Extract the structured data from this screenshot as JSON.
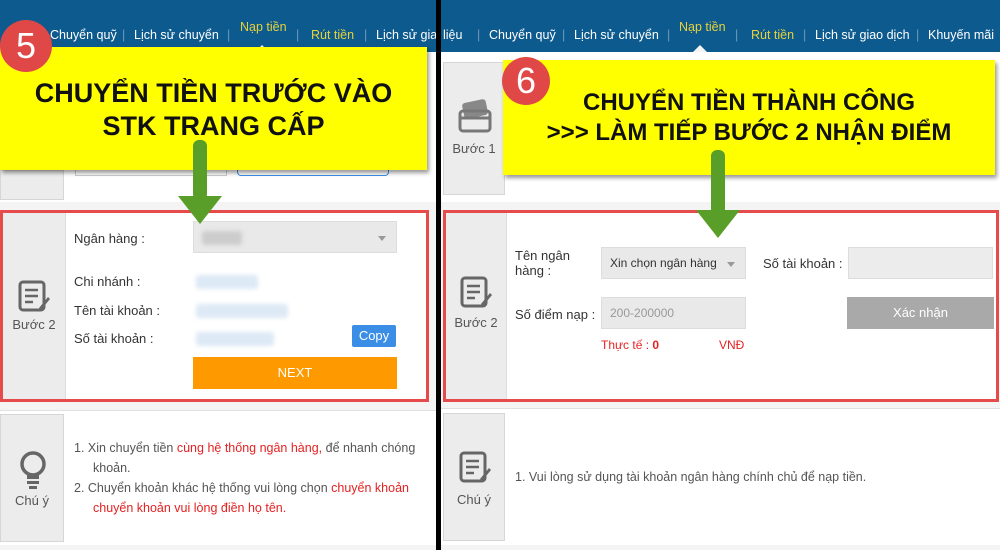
{
  "left": {
    "nav": [
      "Chuyển quỹ",
      "Lịch sử chuyển",
      "Nạp tiền",
      "Rút tiền",
      "Lịch sử giao"
    ],
    "badge": "5",
    "callout": [
      "CHUYỂN TIỀN TRƯỚC VÀO",
      "STK TRANG CẤP"
    ],
    "step2": {
      "label": "Bước 2",
      "bank_label": "Ngân hàng :",
      "branch_label": "Chi nhánh :",
      "account_name_label": "Tên tài khoản :",
      "account_number_label": "Số tài khoản :",
      "copy": "Copy",
      "next": "NEXT"
    },
    "note": {
      "label": "Chú ý",
      "line1a": "1.  Xin chuyển tiền ",
      "line1b": "cùng hệ thống ngân hàng,",
      "line1c": " để nhanh chóng",
      "line1d": "khoản.",
      "line2a": "2.  Chuyển khoản khác hệ thống vui lòng chọn ",
      "line2b": "chuyển khoản",
      "line2c": "chuyển khoản vui lòng điền họ tên."
    }
  },
  "right": {
    "nav": [
      "liệu",
      "Chuyển quỹ",
      "Lịch sử chuyển",
      "Nạp tiền",
      "Rút tiền",
      "Lịch sử giao dịch",
      "Khuyến mãi"
    ],
    "badge": "6",
    "callout": [
      "CHUYỂN TIỀN THÀNH CÔNG",
      ">>> LÀM TIẾP BƯỚC 2 NHẬN ĐIỂM"
    ],
    "step1_label": "Bước 1",
    "step2": {
      "label": "Bước 2",
      "bank_label": "Tên ngân hàng :",
      "bank_select": "Xin chọn ngân hàng",
      "account_label": "Số tài khoản :",
      "points_label": "Số điểm nạp :",
      "points_placeholder": "200-200000",
      "actual_label": "Thực tế :",
      "actual_value": "0",
      "currency": "VNĐ",
      "confirm": "Xác nhận"
    },
    "note": {
      "label": "Chú ý",
      "line1": "1.  Vui lòng sử dụng tài khoản ngân hàng chính chủ để nạp tiền."
    }
  },
  "colors": {
    "nav": "#0d5a8e",
    "callout": "#ffff00",
    "badge": "#e04848",
    "highlight_border": "#e54b4b",
    "next": "#ff9900",
    "copy": "#3a8ee6",
    "arrow": "#5a9e2a"
  }
}
